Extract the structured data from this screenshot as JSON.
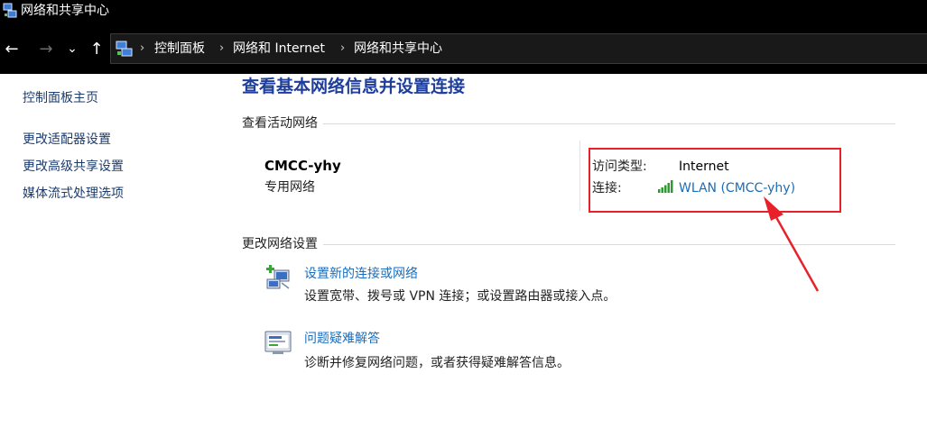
{
  "window": {
    "title": "网络和共享中心",
    "icon": "network-center-icon"
  },
  "nav": {
    "back_icon": "←",
    "forward_icon": "→",
    "recent_icon": "⌄",
    "up_icon": "↑"
  },
  "address_bar": {
    "location_icon": "control-panel-icon",
    "separator": "›",
    "crumbs": [
      "控制面板",
      "网络和 Internet",
      "网络和共享中心"
    ]
  },
  "sidebar": {
    "items": [
      {
        "label": "控制面板主页"
      },
      {
        "label": "更改适配器设置"
      },
      {
        "label": "更改高级共享设置"
      },
      {
        "label": "媒体流式处理选项"
      }
    ]
  },
  "main": {
    "heading": "查看基本网络信息并设置连接",
    "active_networks": {
      "section_title": "查看活动网络",
      "network_name": "CMCC-yhy",
      "network_category": "专用网络",
      "access_type_label": "访问类型:",
      "access_type_value": "Internet",
      "connection_label": "连接:",
      "connection_value": "WLAN (CMCC-yhy)",
      "connection_icon": "wifi-signal-icon"
    },
    "change_settings": {
      "section_title": "更改网络设置",
      "tasks": [
        {
          "icon": "new-connection-icon",
          "link": "设置新的连接或网络",
          "description": "设置宽带、拨号或 VPN 连接；或设置路由器或接入点。"
        },
        {
          "icon": "troubleshoot-icon",
          "link": "问题疑难解答",
          "description": "诊断并修复网络问题，或者获得疑难解答信息。"
        }
      ]
    }
  },
  "annotation": {
    "highlight_color": "#e8202a"
  },
  "colors": {
    "link": "#1a6dbd",
    "heading": "#1e3e9a",
    "chrome_bg": "#000000"
  }
}
